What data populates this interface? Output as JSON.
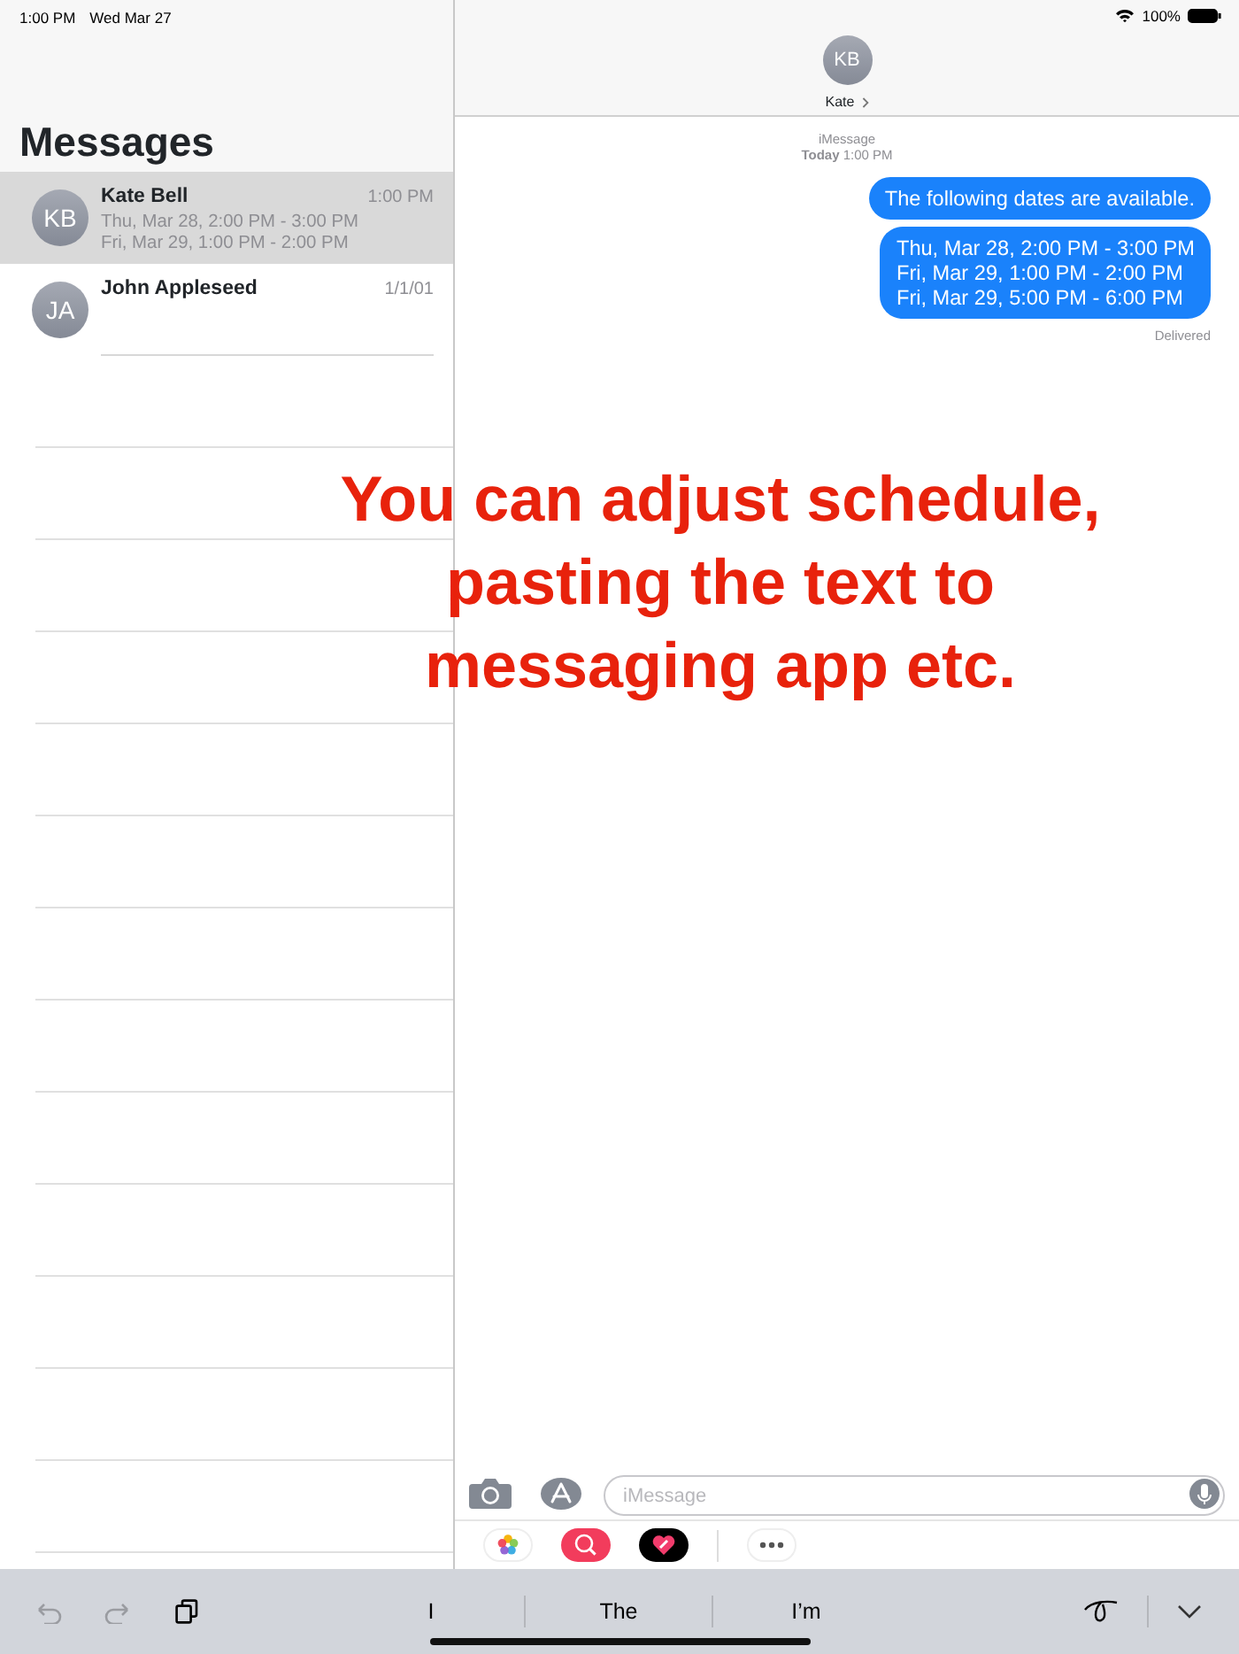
{
  "status_bar": {
    "time": "1:00 PM",
    "date": "Wed Mar 27",
    "battery": "100%"
  },
  "sidebar": {
    "title": "Messages",
    "conversations": [
      {
        "initials": "KB",
        "name": "Kate Bell",
        "time": "1:00 PM",
        "preview": [
          "Thu, Mar 28, 2:00 PM - 3:00 PM",
          "Fri, Mar 29, 1:00 PM - 2:00 PM"
        ],
        "selected": true
      },
      {
        "initials": "JA",
        "name": "John Appleseed",
        "time": "1/1/01",
        "selected": false
      }
    ]
  },
  "conversation": {
    "initials": "KB",
    "name": "Kate",
    "service": "iMessage",
    "timestamp": "**Today** 1:00 PM",
    "messages": [
      {
        "lines": [
          "The following dates are available."
        ]
      },
      {
        "lines": [
          "Thu, Mar 28, 2:00 PM - 3:00 PM",
          "Fri, Mar 29, 1:00 PM - 2:00 PM",
          "Fri, Mar 29, 5:00 PM - 6:00 PM"
        ]
      }
    ],
    "delivery": "Delivered",
    "composer": {
      "placeholder": "iMessage"
    }
  },
  "keyboard_bar": {
    "suggestions": [
      "I",
      "The",
      "I’m"
    ]
  },
  "caption": [
    "You can adjust schedule,",
    "pasting the text to",
    "messaging app etc."
  ]
}
